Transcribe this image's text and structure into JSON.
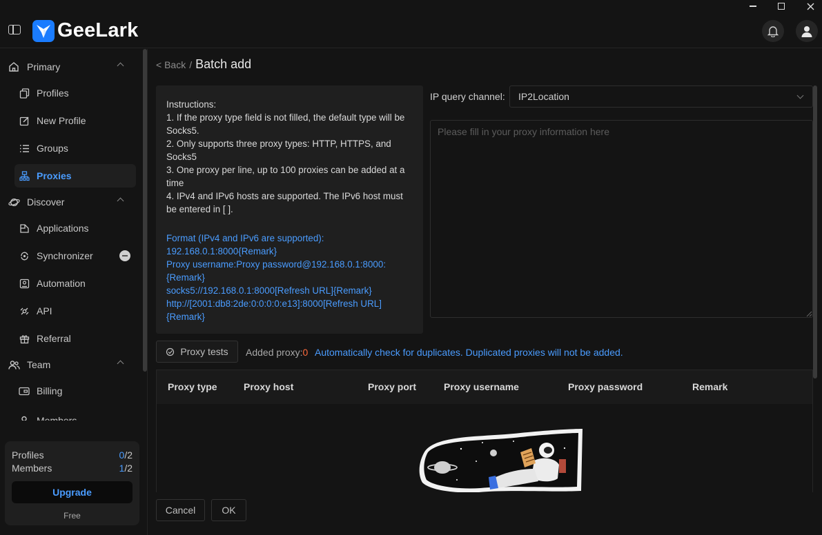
{
  "app": {
    "brand": "GeeLark"
  },
  "window": {
    "minimize": "—",
    "maximize": "☐",
    "close": "✕"
  },
  "sidebar": {
    "groups": [
      {
        "label": "Primary",
        "icon": "home-icon"
      },
      {
        "label": "Discover",
        "icon": "planet-icon"
      },
      {
        "label": "Team",
        "icon": "team-icon"
      }
    ],
    "items": [
      {
        "label": "Profiles",
        "icon": "profiles-icon"
      },
      {
        "label": "New Profile",
        "icon": "edit-icon"
      },
      {
        "label": "Groups",
        "icon": "list-icon"
      },
      {
        "label": "Proxies",
        "icon": "proxies-icon",
        "active": true
      },
      {
        "label": "Applications",
        "icon": "applications-icon"
      },
      {
        "label": "Synchronizer",
        "icon": "synchronizer-icon"
      },
      {
        "label": "Automation",
        "icon": "automation-icon"
      },
      {
        "label": "API",
        "icon": "api-icon"
      },
      {
        "label": "Referral",
        "icon": "gift-icon"
      },
      {
        "label": "Billing",
        "icon": "billing-icon"
      },
      {
        "label": "Members",
        "icon": "members-icon"
      }
    ],
    "plan": {
      "profiles_label": "Profiles",
      "profiles_used": "0",
      "profiles_total": "/2",
      "members_label": "Members",
      "members_used": "1",
      "members_total": "/2",
      "upgrade_label": "Upgrade",
      "plan_name": "Free"
    }
  },
  "breadcrumb": {
    "back": "< Back",
    "separator": "/",
    "title": "Batch add"
  },
  "instructions": {
    "heading": "Instructions:",
    "lines": [
      "1. If the proxy type field is not filled, the default type will be Socks5.",
      "2. Only supports three proxy types: HTTP, HTTPS, and Socks5",
      "3. One proxy per line, up to 100 proxies can be added at a time",
      "4. IPv4 and IPv6 hosts are supported. The IPv6 host must be entered in [ ]."
    ],
    "format_heading": "Format (IPv4 and IPv6 are supported):",
    "formats": [
      "192.168.0.1:8000{Remark}",
      "Proxy username:Proxy password@192.168.0.1:8000:{Remark}",
      "socks5://192.168.0.1:8000[Refresh URL]{Remark}",
      "http://[2001:db8:2de:0:0:0:0:e13]:8000[Refresh URL]{Remark}"
    ]
  },
  "ip_query": {
    "label": "IP query channel:",
    "value": "IP2Location"
  },
  "proxy_input": {
    "placeholder": "Please fill in your proxy information here",
    "value": ""
  },
  "actions": {
    "proxy_tests": "Proxy tests",
    "added_label": "Added proxy:",
    "added_count": "0",
    "duplicate_note": "Automatically check for duplicates. Duplicated proxies will not be added.",
    "cancel": "Cancel",
    "ok": "OK"
  },
  "table": {
    "columns": [
      "Proxy type",
      "Proxy host",
      "Proxy port",
      "Proxy username",
      "Proxy password",
      "Remark"
    ],
    "rows": []
  },
  "colors": {
    "accent": "#4a9cff",
    "brand": "#1a7cff",
    "count": "#ff6b3d",
    "background": "#141414",
    "panel": "#1f1f1f"
  }
}
